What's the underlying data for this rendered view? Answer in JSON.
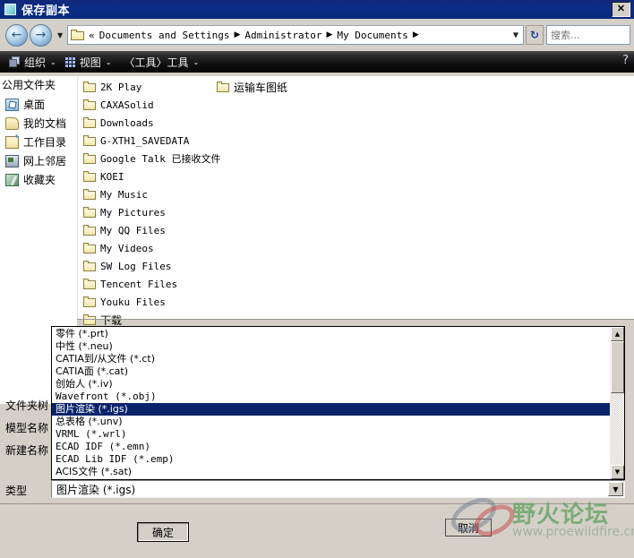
{
  "window": {
    "title": "保存副本",
    "title_icon": "document-square-icon",
    "close_label": "✕",
    "bg_color": "#d4d0c8",
    "titlebar_color": "#0a2d87"
  },
  "nav": {
    "back_icon": "back-arrow-icon",
    "back_glyph": "←",
    "forward_icon": "forward-arrow-icon",
    "forward_glyph": "→",
    "history_caret": "▼",
    "address": {
      "folder_icon": "folder-icon",
      "overflow": "«",
      "crumbs": [
        "Documents and Settings",
        "Administrator",
        "My Documents"
      ],
      "separator": "▶",
      "trailing_separator": "▶",
      "dropdown_arrow": "▼"
    },
    "refresh_icon": "refresh-icon",
    "refresh_glyph": "↻",
    "search": {
      "placeholder": "搜索...",
      "value": ""
    }
  },
  "toolbar": {
    "items": [
      {
        "label": "组织",
        "icon": "organize-icon",
        "chevron": "⌄"
      },
      {
        "label": "视图",
        "icon": "view-grid-icon",
        "chevron": "⌄"
      },
      {
        "label": "〈工具〉工具",
        "icon": "",
        "chevron": "⌄"
      }
    ],
    "help_icon": "help-cursor-icon",
    "help_glyph": "?"
  },
  "sidebar": {
    "header": "公用文件夹",
    "items": [
      {
        "label": "桌面",
        "icon": "desktop-icon"
      },
      {
        "label": "我的文档",
        "icon": "my-documents-icon"
      },
      {
        "label": "工作目录",
        "icon": "working-directory-icon"
      },
      {
        "label": "网上邻居",
        "icon": "network-neighborhood-icon"
      },
      {
        "label": "收藏夹",
        "icon": "favorites-icon"
      }
    ]
  },
  "file_pane": {
    "column1": [
      "2K Play",
      "CAXASolid",
      "Downloads",
      "G-XTH1_SAVEDATA",
      "Google Talk 已接收文件",
      "KOEI",
      "My Music",
      "My Pictures",
      "My QQ Files",
      "My Videos",
      "SW Log Files",
      "Tencent Files",
      "Youku Files",
      "下载"
    ],
    "column2": [
      "运输车图纸"
    ]
  },
  "type_list": {
    "options": [
      "零件 (*.prt)",
      "中性 (*.neu)",
      "CATIA到/从文件 (*.ct)",
      "CATIA面 (*.cat)",
      "创始人 (*.iv)",
      "Wavefront (*.obj)",
      "图片渲染 (*.igs)",
      "总表格 (*.unv)",
      "VRML (*.wrl)",
      "ECAD IDF (*.emn)",
      "ECAD Lib IDF (*.emp)",
      "ACIS文件 (*.sat)"
    ],
    "selected_index": 6,
    "selected_color": "#0a246a",
    "scroll_up_glyph": "▲",
    "scroll_down_glyph": "▼"
  },
  "form": {
    "label_folder_tree": "文件夹树",
    "label_model_name": "模型名称",
    "label_new_name": "新建名称",
    "label_type": "类型",
    "type_value": "图片渲染 (*.igs)",
    "type_dropdown_glyph": "▼"
  },
  "actions": {
    "ok_label": "确定",
    "cancel_label": "取消"
  },
  "watermark": {
    "title": "野火论坛",
    "url": "www.proewildfire.cn",
    "logo_icon": "rings-logo-icon"
  }
}
